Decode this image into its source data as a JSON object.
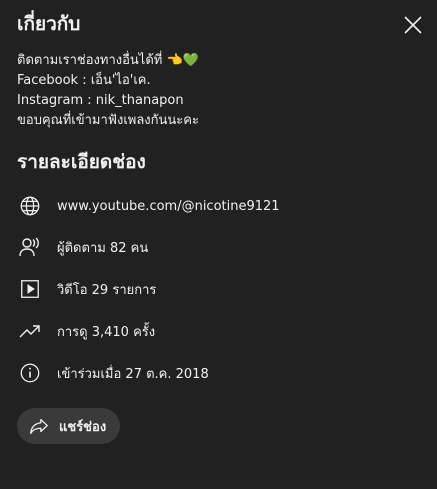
{
  "header": {
    "title": "เกี่ยวกับ",
    "close_icon": "close-icon"
  },
  "description": {
    "lines": [
      "ติดตามเราช่องทางอื่นได้ที่ 👈",
      "Facebook : เอ็น'ไอ'เค.",
      "Instagram : nik_thanapon",
      "ขอบคุณที่เข้ามาฟังเพลงกันนะคะ"
    ],
    "heart": "💚"
  },
  "details": {
    "title": "รายละเอียดช่อง",
    "url": "www.youtube.com/@nicotine9121",
    "subscribers": "ผู้ติดตาม 82 คน",
    "videos": "วิดีโอ 29 รายการ",
    "views": "การดู 3,410 ครั้ง",
    "joined": "เข้าร่วมเมื่อ 27 ต.ค. 2018"
  },
  "share": {
    "label": "แชร์ช่อง",
    "icon": "share-icon"
  },
  "colors": {
    "background": "#212121",
    "text": "#f1f1f1",
    "button_bg": "#3a3a3a"
  }
}
